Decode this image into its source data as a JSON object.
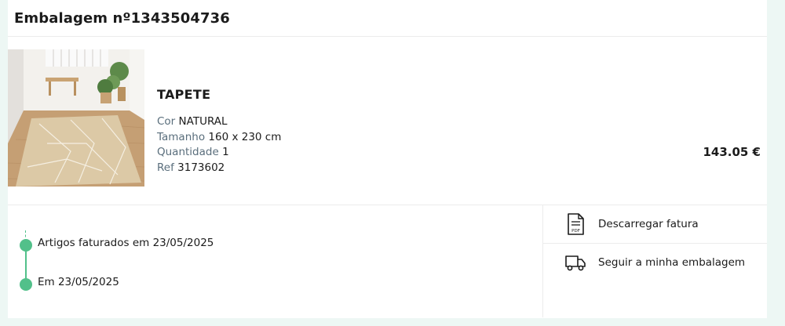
{
  "package": {
    "title": "Embalagem nº1343504736"
  },
  "product": {
    "name": "TAPETE",
    "attributes": [
      {
        "label": "Cor",
        "value": "NATURAL"
      },
      {
        "label": "Tamanho",
        "value": "160 x 230 cm"
      },
      {
        "label": "Quantidade",
        "value": "1"
      },
      {
        "label": "Ref",
        "value": "3173602"
      }
    ],
    "price": "143.05 €",
    "image_icon": "rug-product-photo"
  },
  "timeline": {
    "events": [
      {
        "text": "Artigos faturados em 23/05/2025"
      },
      {
        "text": "Em 23/05/2025"
      }
    ],
    "accent_color": "#52c08a"
  },
  "actions": [
    {
      "label": "Descarregar fatura",
      "icon": "pdf-document-icon",
      "icon_text": "PDF"
    },
    {
      "label": "Seguir a minha embalagem",
      "icon": "delivery-truck-icon"
    }
  ]
}
